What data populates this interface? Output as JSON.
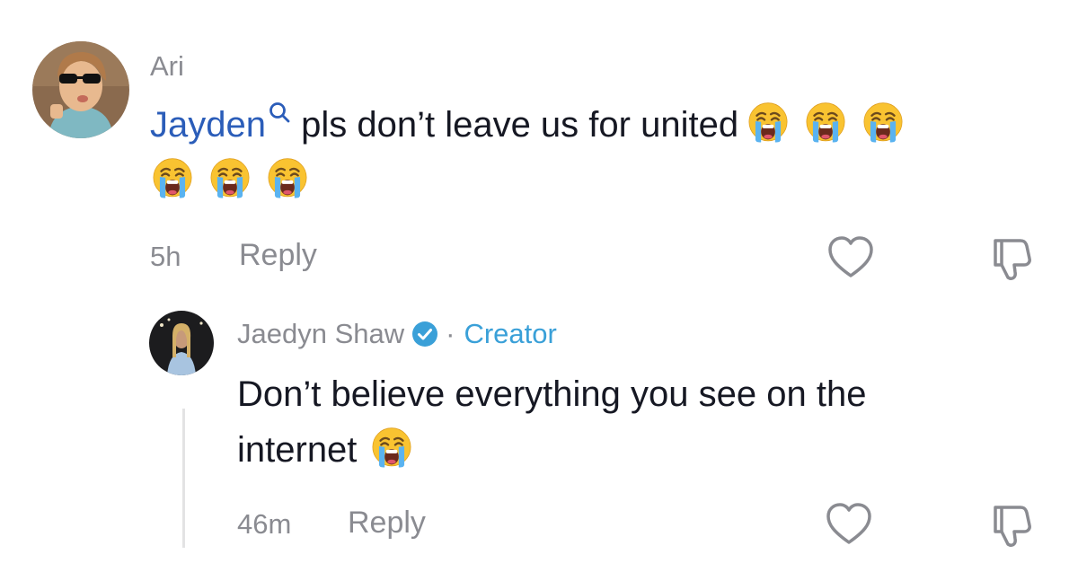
{
  "comment": {
    "username": "Ari",
    "mention": "Jayden",
    "text_line1": " pls don’t leave us for united",
    "time": "5h",
    "reply_label": "Reply"
  },
  "reply": {
    "username": "Jaedyn Shaw",
    "separator": "·",
    "creator_label": "Creator",
    "text_line1": "Don’t believe everything you see on the",
    "text_line2": "internet",
    "time": "46m",
    "reply_label": "Reply"
  },
  "icons": {
    "like": "heart-outline-icon",
    "dislike": "thumbs-down-outline-icon",
    "verified": "verified-badge-icon",
    "emoji": "loudly-crying-face-emoji"
  },
  "colors": {
    "mention": "#2b5db9",
    "creator": "#3aa0d8",
    "muted": "#8a8b91"
  }
}
